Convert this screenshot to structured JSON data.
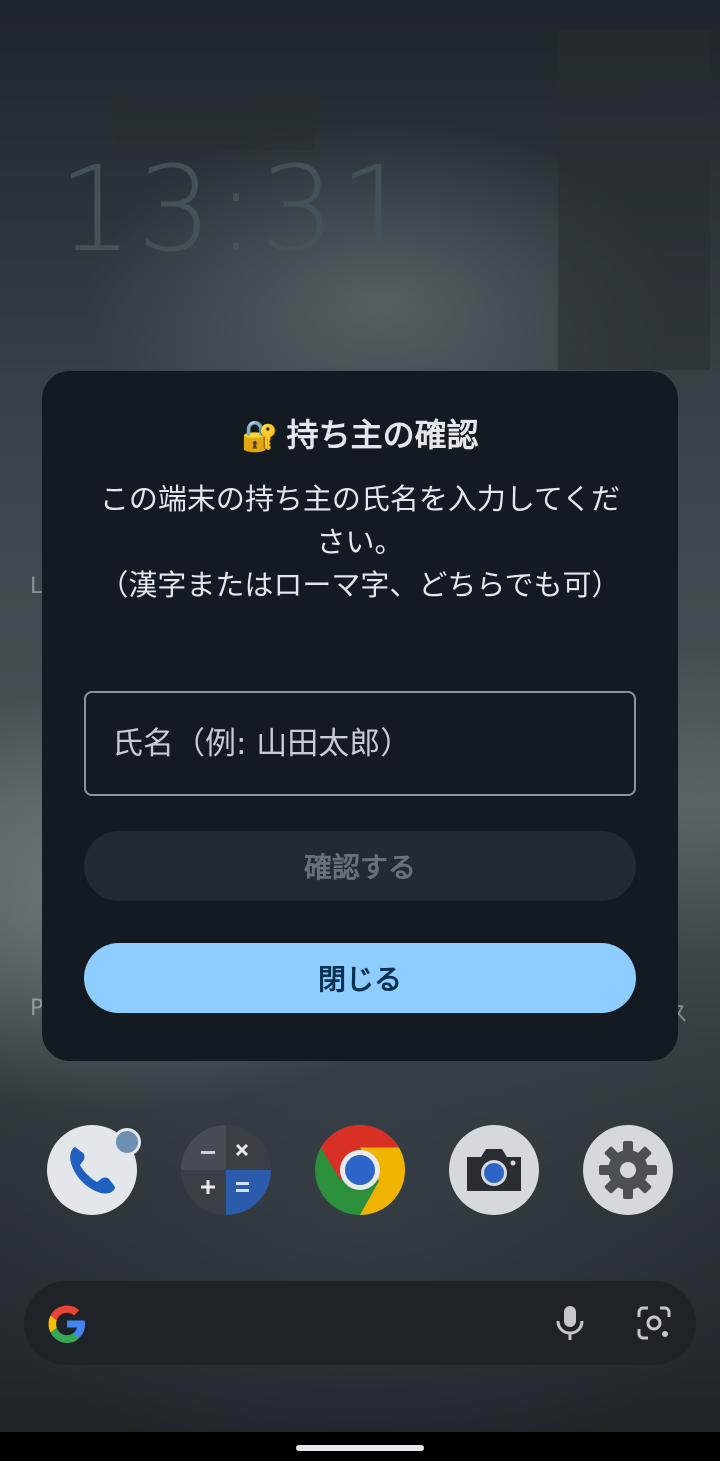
{
  "lockscreen": {
    "clock": "13:31",
    "left_fragment_1": "L",
    "left_fragment_2": "P",
    "right_fragment": "ス"
  },
  "dialog": {
    "lock_icon": "🔐",
    "title": "持ち主の確認",
    "message_line1": "この端末の持ち主の氏名を入力してください。",
    "message_line2": "（漢字またはローマ字、どちらでも可）",
    "name_placeholder": "氏名（例: 山田太郎）",
    "name_value": "",
    "confirm_label": "確認する",
    "close_label": "閉じる"
  },
  "dock": {
    "apps": [
      "phone",
      "calculator",
      "chrome",
      "camera",
      "settings"
    ]
  },
  "search": {
    "icons": [
      "google-icon",
      "microphone-icon",
      "lens-icon"
    ]
  },
  "colors": {
    "dialog_bg": "#141a21",
    "primary_button": "#8dcdff",
    "disabled_button": "#242a32"
  }
}
